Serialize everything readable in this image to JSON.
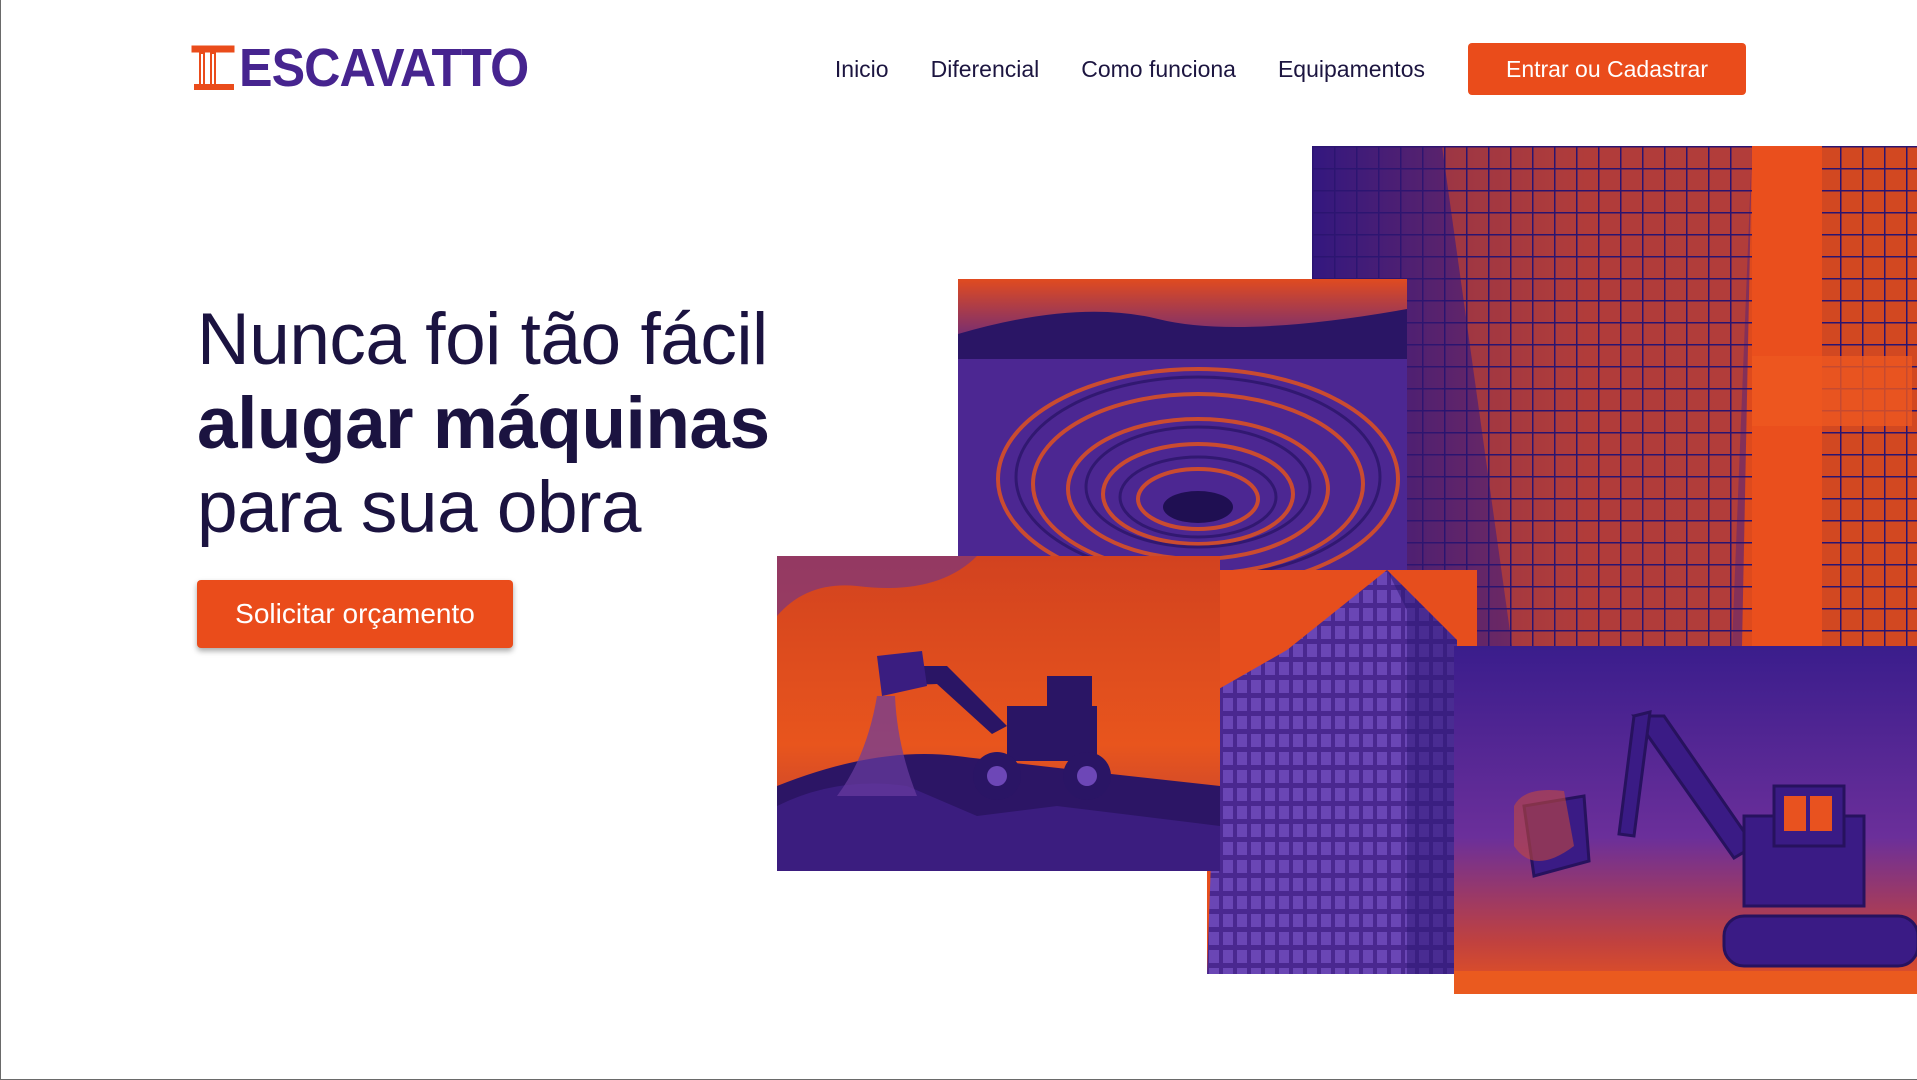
{
  "header": {
    "logo_text": "ESCAVATTO",
    "nav": [
      {
        "label": "Inicio"
      },
      {
        "label": "Diferencial"
      },
      {
        "label": "Como funciona"
      },
      {
        "label": "Equipamentos"
      }
    ],
    "cta_label": "Entrar ou Cadastrar"
  },
  "hero": {
    "line1": "Nunca foi tão fácil",
    "line2": "alugar máquinas",
    "line3": "para sua obra",
    "cta_label": "Solicitar orçamento"
  },
  "collage": [
    {
      "name": "skyscrapers-photo"
    },
    {
      "name": "open-pit-mine-photo"
    },
    {
      "name": "wheel-loader-photo"
    },
    {
      "name": "office-building-photo"
    },
    {
      "name": "excavator-photo"
    }
  ],
  "colors": {
    "brand_orange": "#ea4c1b",
    "brand_purple": "#46248f",
    "text_dark": "#1b1340"
  }
}
